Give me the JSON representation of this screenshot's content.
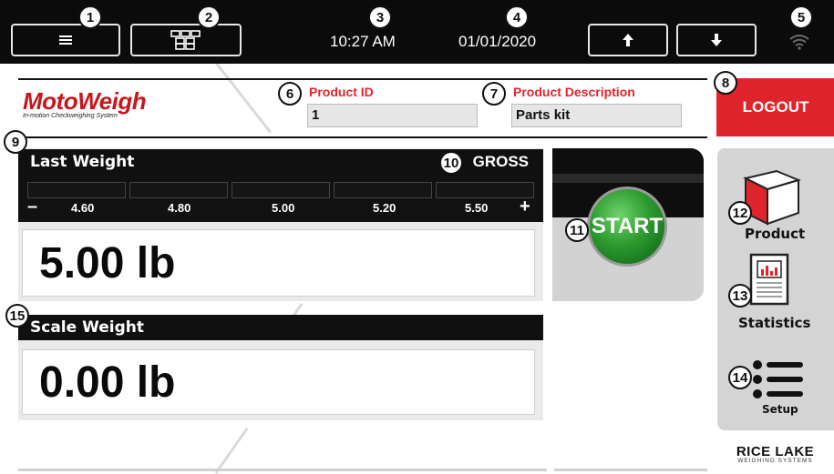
{
  "topbar": {
    "time": "10:27 AM",
    "date": "01/01/2020"
  },
  "callouts": [
    "1",
    "2",
    "3",
    "4",
    "5",
    "6",
    "7",
    "8",
    "9",
    "10",
    "11",
    "12",
    "13",
    "14",
    "15"
  ],
  "header": {
    "logo_text": "MotoWeigh",
    "logo_tagline": "In-motion Checkweighing System",
    "product_id_label": "Product ID",
    "product_id_value": "1",
    "product_desc_label": "Product Description",
    "product_desc_value": "Parts kit",
    "logout_label": "LOGOUT"
  },
  "last_weight": {
    "title": "Last Weight",
    "mode": "GROSS",
    "scale_ticks": [
      "4.60",
      "4.80",
      "5.00",
      "5.20",
      "5.50"
    ],
    "minus": "–",
    "plus": "+",
    "value": "5.00 lb"
  },
  "scale_weight": {
    "title": "Scale Weight",
    "value": "0.00 lb"
  },
  "start_label": "START",
  "sidebar": {
    "product_label": "Product",
    "statistics_label": "Statistics",
    "setup_label": "Setup"
  },
  "brand": {
    "name": "RICE LAKE",
    "sub": "WEIGHING SYSTEMS"
  },
  "colors": {
    "accent_red": "#e0242b",
    "topbar": "#0b0b0b",
    "start_green": "#2c9a2f"
  }
}
